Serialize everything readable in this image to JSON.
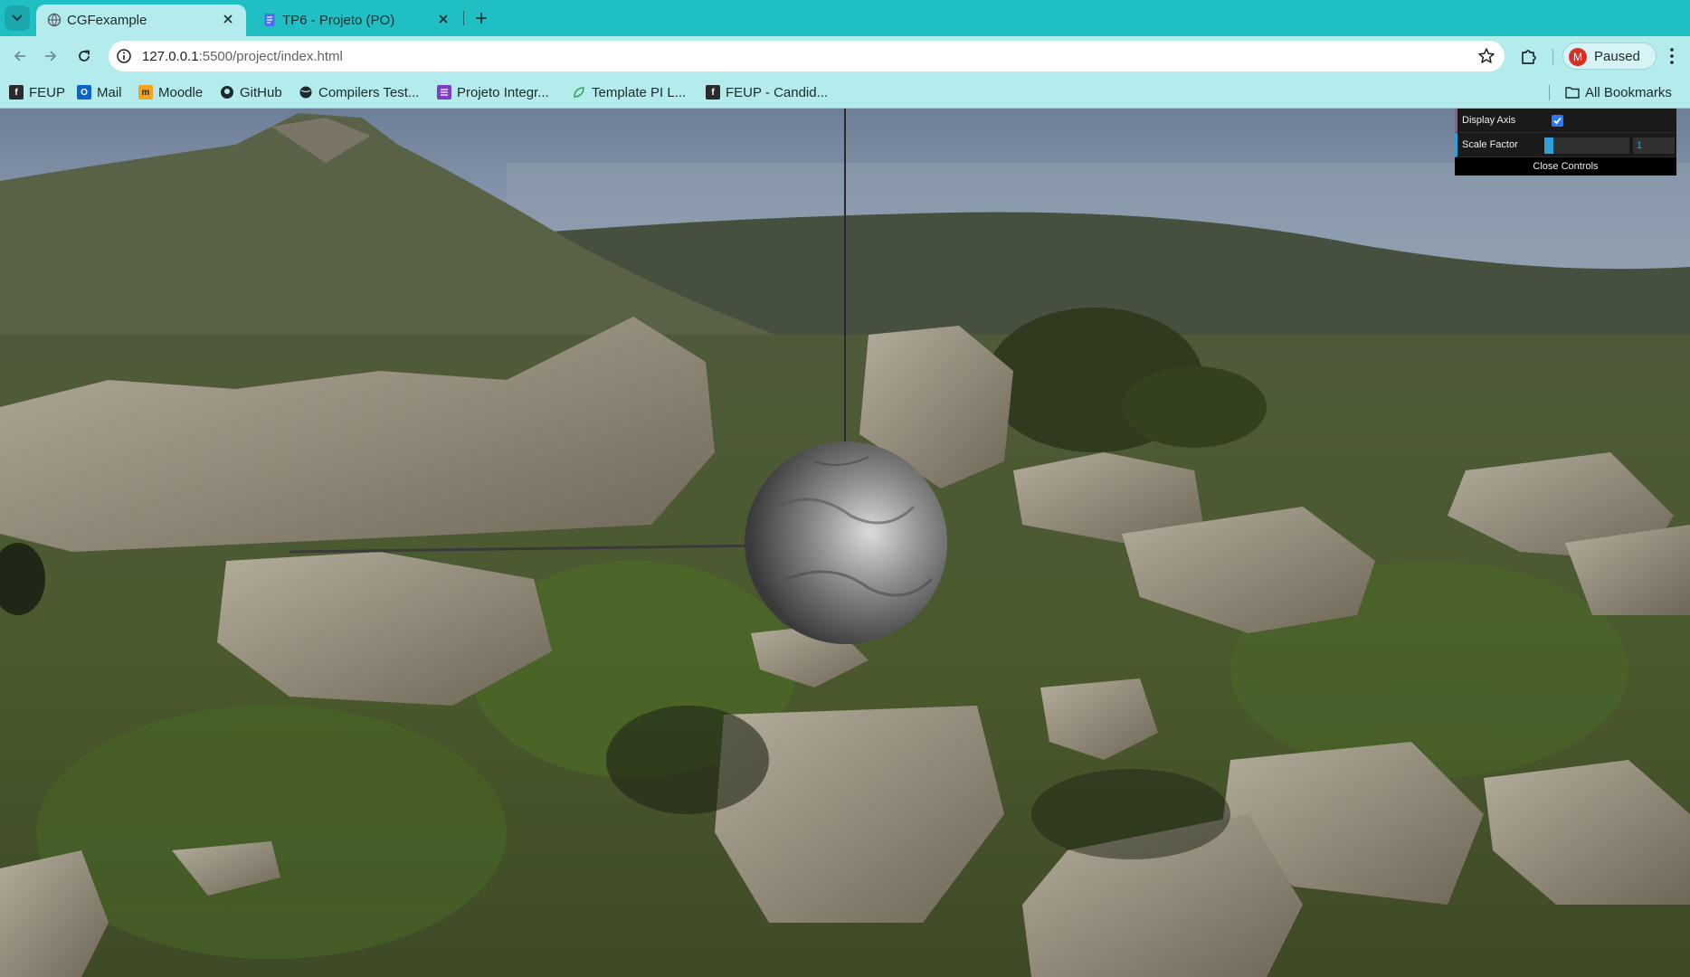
{
  "browser": {
    "tabs": [
      {
        "title": "CGFexample",
        "active": true
      },
      {
        "title": "TP6 - Projeto (PO)",
        "active": false
      }
    ],
    "url_host": "127.0.0.1",
    "url_path": ":5500/project/index.html",
    "profile": {
      "initial": "M",
      "label": "Paused"
    },
    "bookmarks": [
      {
        "label": "FEUP",
        "icon": "feup-icon"
      },
      {
        "label": "Mail",
        "icon": "outlook-icon"
      },
      {
        "label": "Moodle",
        "icon": "moodle-icon"
      },
      {
        "label": "GitHub",
        "icon": "github-icon"
      },
      {
        "label": "Compilers Test...",
        "icon": "globe-icon"
      },
      {
        "label": "Projeto Integr...",
        "icon": "forms-icon"
      },
      {
        "label": "Template PI L...",
        "icon": "leaf-icon"
      },
      {
        "label": "FEUP - Candid...",
        "icon": "feup-icon"
      }
    ],
    "all_bookmarks": "All Bookmarks"
  },
  "gui": {
    "display_axis": {
      "label": "Display Axis",
      "checked": true
    },
    "scale_factor": {
      "label": "Scale Factor",
      "value": "1",
      "fraction": 0.11
    },
    "close_label": "Close Controls"
  },
  "colors": {
    "tabstrip": "#1fbfc4",
    "toolbar": "#b4ecee",
    "gui_accent": "#2fa1d6"
  }
}
